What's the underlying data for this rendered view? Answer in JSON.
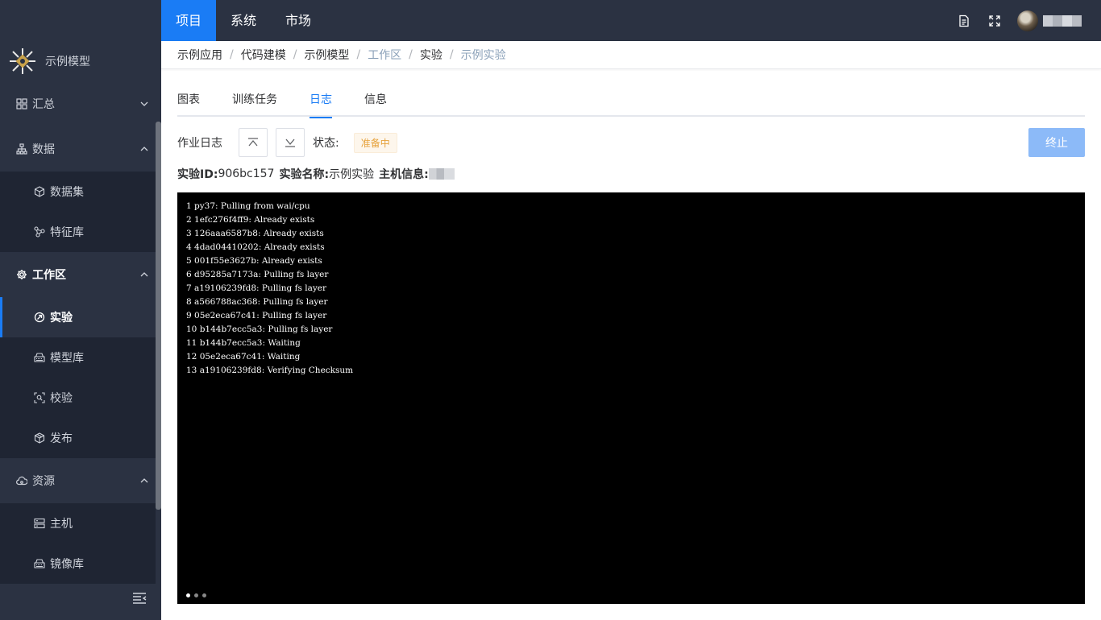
{
  "top_nav": {
    "items": [
      {
        "label": "项目",
        "active": true
      },
      {
        "label": "系统",
        "active": false
      },
      {
        "label": "市场",
        "active": false
      }
    ],
    "icons": [
      "document-icon",
      "fullscreen-icon"
    ]
  },
  "sidebar": {
    "brand": "示例模型",
    "groups": [
      {
        "label": "汇总",
        "icon": "grid-icon",
        "expanded": false,
        "items": []
      },
      {
        "label": "数据",
        "icon": "hierarchy-icon",
        "expanded": true,
        "items": [
          {
            "label": "数据集",
            "icon": "cube-icon"
          },
          {
            "label": "特征库",
            "icon": "nodes-icon"
          }
        ]
      },
      {
        "label": "工作区",
        "icon": "gear-icon",
        "expanded": true,
        "active": true,
        "items": [
          {
            "label": "实验",
            "icon": "experiment-icon",
            "active": true
          },
          {
            "label": "模型库",
            "icon": "model-icon"
          },
          {
            "label": "校验",
            "icon": "scan-icon"
          },
          {
            "label": "发布",
            "icon": "box-icon"
          }
        ]
      },
      {
        "label": "资源",
        "icon": "cloud-icon",
        "expanded": true,
        "items": [
          {
            "label": "主机",
            "icon": "server-icon"
          },
          {
            "label": "镜像库",
            "icon": "model-icon"
          }
        ]
      }
    ]
  },
  "breadcrumb": [
    {
      "label": "示例应用",
      "link": false
    },
    {
      "label": "代码建模",
      "link": false
    },
    {
      "label": "示例模型",
      "link": false
    },
    {
      "label": "工作区",
      "link": true
    },
    {
      "label": "实验",
      "link": false
    },
    {
      "label": "示例实验",
      "link": true
    }
  ],
  "tabs": [
    {
      "label": "图表",
      "active": false
    },
    {
      "label": "训练任务",
      "active": false
    },
    {
      "label": "日志",
      "active": true
    },
    {
      "label": "信息",
      "active": false
    }
  ],
  "log": {
    "label": "作业日志",
    "status_label": "状态:",
    "status_value": "准备中",
    "stop_button": "终止"
  },
  "info": {
    "id_label": "实验ID:",
    "id_value": "906bc157",
    "name_label": "实验名称:",
    "name_value": "示例实验",
    "host_label": "主机信息:"
  },
  "terminal": {
    "lines": [
      "1 py37: Pulling from wai/cpu",
      "2 1efc276f4ff9: Already exists",
      "3 126aaa6587b8: Already exists",
      "4 4dad04410202: Already exists",
      "5 001f55e3627b: Already exists",
      "6 d95285a7173a: Pulling fs layer",
      "7 a19106239fd8: Pulling fs layer",
      "8 a566788ac368: Pulling fs layer",
      "9 05e2eca67c41: Pulling fs layer",
      "10 b144b7ecc5a3: Pulling fs layer",
      "11 b144b7ecc5a3: Waiting",
      "12 05e2eca67c41: Waiting",
      "13 a19106239fd8: Verifying Checksum"
    ]
  },
  "colors": {
    "sidebar_bg": "#2b3242",
    "submenu_bg": "#1f2533",
    "accent": "#1a7cf5",
    "status_warning": "#e6a23c",
    "stop_button_bg": "#8cbaf8"
  }
}
